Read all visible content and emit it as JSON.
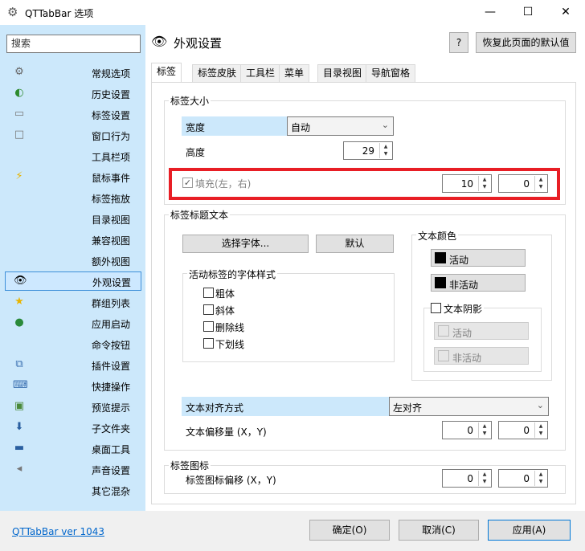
{
  "window": {
    "title": "QTTabBar 选项",
    "minimize_glyph": "—",
    "maximize_glyph": "☐",
    "close_glyph": "✕"
  },
  "sidebar": {
    "search_placeholder": "搜索",
    "items": [
      {
        "label": "常规选项",
        "icon": "gear-icon"
      },
      {
        "label": "历史设置",
        "icon": "history-icon"
      },
      {
        "label": "标签设置",
        "icon": "tab-icon"
      },
      {
        "label": "窗口行为",
        "icon": "window-icon"
      },
      {
        "label": "工具栏项",
        "icon": ""
      },
      {
        "label": "鼠标事件",
        "icon": "lightning-icon"
      },
      {
        "label": "标签拖放",
        "icon": ""
      },
      {
        "label": "目录视图",
        "icon": ""
      },
      {
        "label": "兼容视图",
        "icon": ""
      },
      {
        "label": "额外视图",
        "icon": ""
      },
      {
        "label": "外观设置",
        "icon": "eye-icon",
        "selected": true
      },
      {
        "label": "群组列表",
        "icon": "star-icon"
      },
      {
        "label": "应用启动",
        "icon": "app-icon"
      },
      {
        "label": "命令按钮",
        "icon": ""
      },
      {
        "label": "插件设置",
        "icon": "plugin-icon"
      },
      {
        "label": "快捷操作",
        "icon": "keyboard-icon"
      },
      {
        "label": "预览提示",
        "icon": "preview-icon"
      },
      {
        "label": "子文件夹",
        "icon": "subfolder-icon"
      },
      {
        "label": "桌面工具",
        "icon": "desktop-icon"
      },
      {
        "label": "声音设置",
        "icon": "speaker-icon"
      },
      {
        "label": "其它混杂",
        "icon": ""
      }
    ]
  },
  "header": {
    "title": "外观设置",
    "help_label": "?",
    "restore_defaults_label": "恢复此页面的默认值"
  },
  "tabs": [
    "标签",
    "标签皮肤",
    "工具栏",
    "菜单",
    "目录视图",
    "导航窗格"
  ],
  "tab_size": {
    "group_title": "标签大小",
    "width_label": "宽度",
    "width_value": "自动",
    "height_label": "高度",
    "height_value": "29",
    "padding_label": "填充(左，右)",
    "padding_left": "10",
    "padding_right": "0"
  },
  "title_text": {
    "group_title": "标签标题文本",
    "choose_font_label": "选择字体...",
    "default_label": "默认",
    "font_style_group": "活动标签的字体样式",
    "styles": [
      "粗体",
      "斜体",
      "删除线",
      "下划线"
    ],
    "text_color_group": "文本颜色",
    "active_label": "活动",
    "inactive_label": "非活动",
    "shadow_label": "文本阴影",
    "shadow_active_label": "活动",
    "shadow_inactive_label": "非活动",
    "align_label": "文本对齐方式",
    "align_value": "左对齐",
    "offset_label": "文本偏移量 (X，Y)",
    "offset_x": "0",
    "offset_y": "0"
  },
  "tab_icon": {
    "group_title": "标签图标",
    "offset_label": "标签图标偏移 (X，Y)",
    "offset_x": "0",
    "offset_y": "0"
  },
  "footer": {
    "version_link": "QTTabBar ver 1043",
    "ok_label": "确定(O)",
    "cancel_label": "取消(C)",
    "apply_label": "应用(A)"
  },
  "colors": {
    "sidebar_bg": "#cce8fb",
    "highlight_border": "#e81e25",
    "link": "#0066cc"
  }
}
